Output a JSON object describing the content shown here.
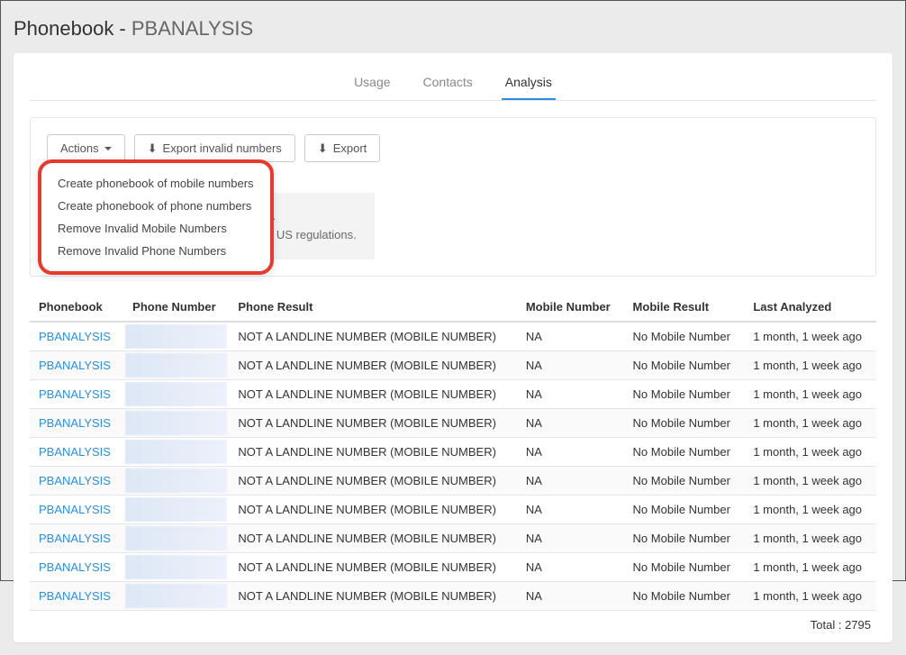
{
  "header": {
    "title_strong": "Phonebook - ",
    "title_light": "PBANALYSIS"
  },
  "tabs": {
    "usage": "Usage",
    "contacts": "Contacts",
    "analysis": "Analysis"
  },
  "toolbar": {
    "actions_label": "Actions",
    "export_invalid_label": "Export invalid numbers",
    "export_label": "Export"
  },
  "actions_menu": {
    "items": [
      "Create phonebook of mobile numbers",
      "Create phonebook of phone numbers",
      "Remove Invalid Mobile Numbers",
      "Remove Invalid Phone Numbers"
    ]
  },
  "note": {
    "line1_tail": "ook continue to be available as contacts.",
    "line2_tail": "ndlines) and text mobile numbers as per US regulations."
  },
  "table": {
    "headers": {
      "phonebook": "Phonebook",
      "phone_number": "Phone Number",
      "phone_result": "Phone Result",
      "mobile_number": "Mobile Number",
      "mobile_result": "Mobile Result",
      "last_analyzed": "Last Analyzed"
    },
    "rows": [
      {
        "phonebook": "PBANALYSIS",
        "phone_number": "",
        "phone_result": "NOT A LANDLINE NUMBER (MOBILE NUMBER)",
        "mobile_number": "NA",
        "mobile_result": "No Mobile Number",
        "last_analyzed": "1 month, 1 week ago"
      },
      {
        "phonebook": "PBANALYSIS",
        "phone_number": "",
        "phone_result": "NOT A LANDLINE NUMBER (MOBILE NUMBER)",
        "mobile_number": "NA",
        "mobile_result": "No Mobile Number",
        "last_analyzed": "1 month, 1 week ago"
      },
      {
        "phonebook": "PBANALYSIS",
        "phone_number": "",
        "phone_result": "NOT A LANDLINE NUMBER (MOBILE NUMBER)",
        "mobile_number": "NA",
        "mobile_result": "No Mobile Number",
        "last_analyzed": "1 month, 1 week ago"
      },
      {
        "phonebook": "PBANALYSIS",
        "phone_number": "",
        "phone_result": "NOT A LANDLINE NUMBER (MOBILE NUMBER)",
        "mobile_number": "NA",
        "mobile_result": "No Mobile Number",
        "last_analyzed": "1 month, 1 week ago"
      },
      {
        "phonebook": "PBANALYSIS",
        "phone_number": "",
        "phone_result": "NOT A LANDLINE NUMBER (MOBILE NUMBER)",
        "mobile_number": "NA",
        "mobile_result": "No Mobile Number",
        "last_analyzed": "1 month, 1 week ago"
      },
      {
        "phonebook": "PBANALYSIS",
        "phone_number": "",
        "phone_result": "NOT A LANDLINE NUMBER (MOBILE NUMBER)",
        "mobile_number": "NA",
        "mobile_result": "No Mobile Number",
        "last_analyzed": "1 month, 1 week ago"
      },
      {
        "phonebook": "PBANALYSIS",
        "phone_number": "",
        "phone_result": "NOT A LANDLINE NUMBER (MOBILE NUMBER)",
        "mobile_number": "NA",
        "mobile_result": "No Mobile Number",
        "last_analyzed": "1 month, 1 week ago"
      },
      {
        "phonebook": "PBANALYSIS",
        "phone_number": "",
        "phone_result": "NOT A LANDLINE NUMBER (MOBILE NUMBER)",
        "mobile_number": "NA",
        "mobile_result": "No Mobile Number",
        "last_analyzed": "1 month, 1 week ago"
      },
      {
        "phonebook": "PBANALYSIS",
        "phone_number": "",
        "phone_result": "NOT A LANDLINE NUMBER (MOBILE NUMBER)",
        "mobile_number": "NA",
        "mobile_result": "No Mobile Number",
        "last_analyzed": "1 month, 1 week ago"
      },
      {
        "phonebook": "PBANALYSIS",
        "phone_number": "",
        "phone_result": "NOT A LANDLINE NUMBER (MOBILE NUMBER)",
        "mobile_number": "NA",
        "mobile_result": "No Mobile Number",
        "last_analyzed": "1 month, 1 week ago"
      }
    ],
    "total_label": "Total : ",
    "total_value": "2795"
  }
}
